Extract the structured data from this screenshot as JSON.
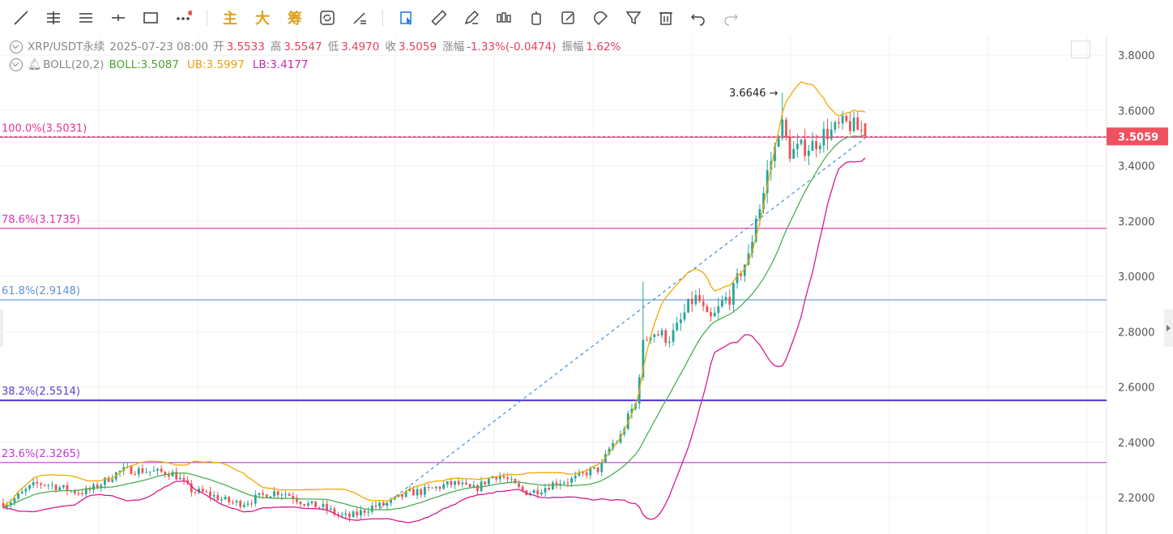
{
  "toolbar": {
    "main_label": "主",
    "big_label": "大",
    "chip_label": "筹"
  },
  "info": {
    "symbol": "XRP/USDT永续",
    "datetime": "2025-07-23 08:00",
    "open_label": "开",
    "open": "3.5533",
    "high_label": "高",
    "high": "3.5547",
    "low_label": "低",
    "low": "3.4970",
    "close_label": "收",
    "close": "3.5059",
    "change_label": "涨幅",
    "change": "-1.33%(-0.0474)",
    "amp_label": "振幅",
    "amp": "1.62%"
  },
  "indicator": {
    "name": "BOLL(20,2)",
    "boll": "BOLL:3.5087",
    "ub": "UB:3.5997",
    "lb": "LB:3.4177"
  },
  "colors": {
    "up": "#26a69a",
    "down": "#ef5350",
    "mid": "#4caf50",
    "upper": "#f2a900",
    "lower": "#d81b8c",
    "price_tag": "#f0515e"
  },
  "chart_data": {
    "type": "candlestick",
    "ylim": [
      2.15,
      3.85
    ],
    "y_ticks": [
      "3.8000",
      "3.6000",
      "3.4000",
      "3.2000",
      "3.0000",
      "2.8000",
      "2.6000",
      "2.4000",
      "2.2000"
    ],
    "last_price": "3.5059",
    "max_label": "3.6646",
    "fibonacci": [
      {
        "label": "100.0%(3.5031)",
        "value": 3.5031,
        "color": "#e8338f"
      },
      {
        "label": "78.6%(3.1735)",
        "value": 3.1735,
        "color": "#e32fb8"
      },
      {
        "label": "61.8%(2.9148)",
        "value": 2.9148,
        "color": "#5b95d6"
      },
      {
        "label": "38.2%(2.5514)",
        "value": 2.5514,
        "color": "#5a3fd6"
      },
      {
        "label": "23.6%(2.3265)",
        "value": 2.3265,
        "color": "#b43fc8"
      }
    ],
    "series_summary": "XRP/USDT candles with BOLL(20,2) bands, rising from ~2.2 to peak 3.6646"
  }
}
